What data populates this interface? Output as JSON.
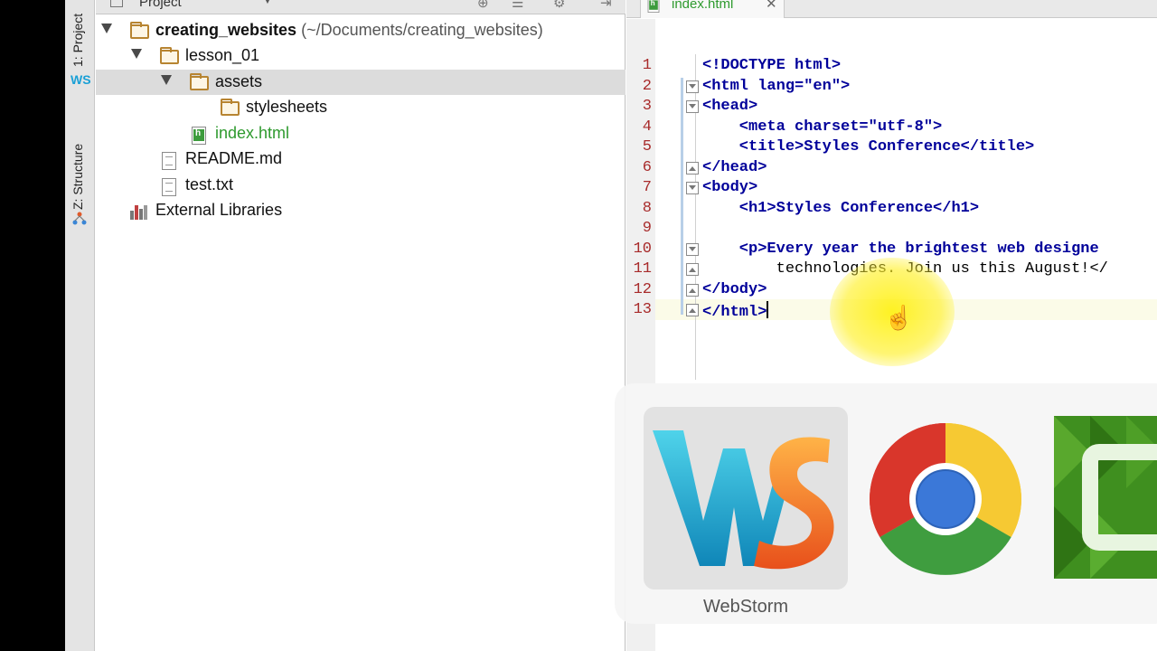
{
  "sidebar": {
    "tabs": [
      {
        "label": "1: Project"
      },
      {
        "label": "Z: Structure"
      }
    ]
  },
  "project_panel": {
    "header_label": "Project",
    "tree": [
      {
        "label": "creating_websites",
        "path": "(~/Documents/creating_websites)",
        "type": "folder",
        "expanded": true
      },
      {
        "label": "lesson_01",
        "type": "folder",
        "expanded": true
      },
      {
        "label": "assets",
        "type": "folder",
        "expanded": true,
        "selected": true
      },
      {
        "label": "stylesheets",
        "type": "folder"
      },
      {
        "label": "index.html",
        "type": "html-file"
      },
      {
        "label": "README.md",
        "type": "text-file"
      },
      {
        "label": "test.txt",
        "type": "text-file"
      },
      {
        "label": "External Libraries",
        "type": "library"
      }
    ]
  },
  "editor": {
    "tab_label": "index.html",
    "line_numbers": [
      "1",
      "2",
      "3",
      "4",
      "5",
      "6",
      "7",
      "8",
      "9",
      "10",
      "11",
      "12",
      "13"
    ],
    "lines": [
      "<!DOCTYPE html>",
      "<html lang=\"en\">",
      "<head>",
      "    <meta charset=\"utf-8\">",
      "    <title>Styles Conference</title>",
      "</head>",
      "<body>",
      "    <h1>Styles Conference</h1>",
      "",
      "    <p>Every year the brightest web designe",
      "        technologies. Join us this August!</",
      "</body>",
      "</html>"
    ],
    "current_line": "13"
  },
  "app_switcher": {
    "selected_app_label": "WebStorm",
    "apps": [
      {
        "icon": "webstorm-icon"
      },
      {
        "icon": "chrome-icon"
      },
      {
        "icon": "camtasia-icon"
      }
    ]
  }
}
